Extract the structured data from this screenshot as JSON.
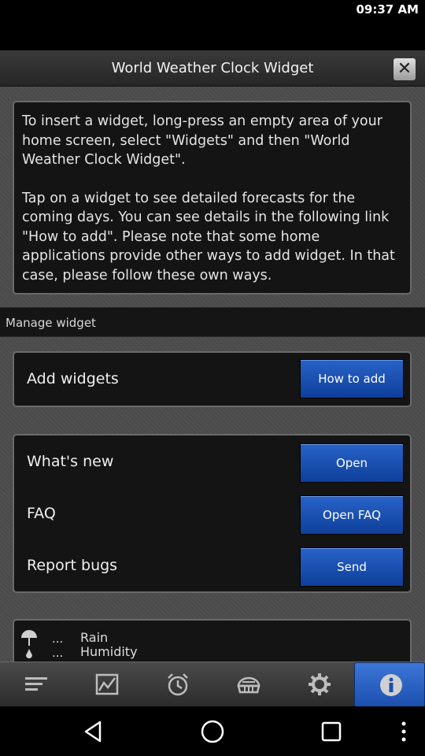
{
  "status_bar": {
    "time": "09:37 AM"
  },
  "dialog": {
    "title": "World Weather Clock Widget",
    "close_icon": "close-icon"
  },
  "info": {
    "paragraph_1": "To insert a widget, long-press an empty area of your home screen, select \"Widgets\" and then \"World Weather Clock Widget\".",
    "paragraph_2": "Tap on a widget to see detailed forecasts for the coming days. You can see details in the following link \"How to add\". Please note that some home applications provide other ways to add widget. In that case, please follow these own ways."
  },
  "manage_section": {
    "header": "Manage widget"
  },
  "add_widgets": {
    "label": "Add widgets",
    "button": "How to add"
  },
  "misc": {
    "rows": [
      {
        "label": "What's new",
        "button": "Open"
      },
      {
        "label": "FAQ",
        "button": "Open FAQ"
      },
      {
        "label": "Report bugs",
        "button": "Send"
      }
    ]
  },
  "weather_preview": {
    "rain_value": "...",
    "rain_label": "Rain",
    "humidity_value": "...",
    "humidity_label": "Humidity",
    "icon": "umbrella-icon"
  },
  "bottom_tabs": [
    {
      "icon": "menu-list-icon",
      "active": false
    },
    {
      "icon": "map-icon",
      "active": false
    },
    {
      "icon": "alarm-clock-icon",
      "active": false
    },
    {
      "icon": "globe-icon",
      "active": false
    },
    {
      "icon": "gear-icon",
      "active": false
    },
    {
      "icon": "info-icon",
      "active": true
    }
  ],
  "nav_bar": [
    "back-icon",
    "home-icon",
    "recents-icon",
    "more-icon"
  ],
  "colors": {
    "button_blue": "#1b4fae",
    "active_tab": "#2c63c4",
    "card_bg": "#141414"
  }
}
